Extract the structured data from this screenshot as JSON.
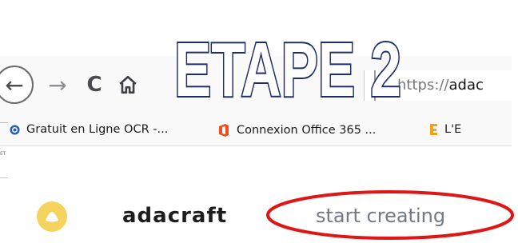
{
  "overlay": {
    "title": "ETAPE 2"
  },
  "toolbar": {
    "back_icon": "back-arrow-icon",
    "back_glyph": "←",
    "forward_icon": "forward-arrow-icon",
    "forward_glyph": "→",
    "reload_icon": "reload-icon",
    "reload_glyph": "C",
    "home_icon": "home-icon",
    "url_prefix": "https://",
    "url_host": "adac"
  },
  "bookmarks": [
    {
      "label": "Gratuit en Ligne OCR -...",
      "icon": "ocr-favicon",
      "color": "#2a5fb0"
    },
    {
      "label": "Connexion Office 365 ...",
      "icon": "office-favicon",
      "color": "#e8501f"
    },
    {
      "label": "L'E",
      "icon": "bookmark-favicon",
      "color": "#f0a21a"
    }
  ],
  "edge_text": "ET",
  "page": {
    "brand": "adacraft",
    "start_label": "start creating",
    "logo_color": "#f4d35e"
  },
  "annotation": {
    "ellipse_color": "#e01515"
  }
}
